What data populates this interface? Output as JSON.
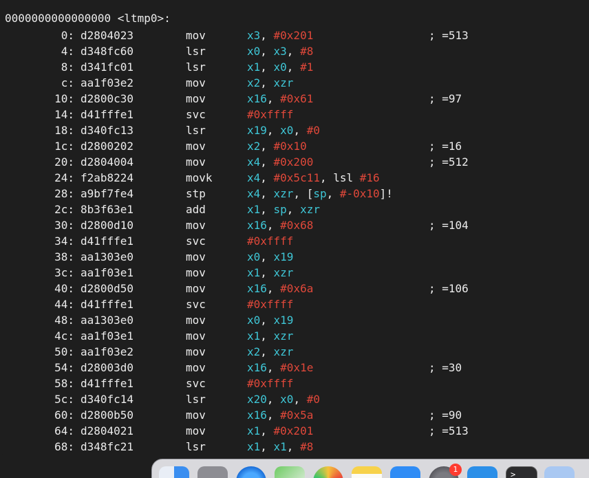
{
  "disassembly": {
    "header": "0000000000000000 <ltmp0>:",
    "rows": [
      {
        "addr": "0:",
        "hex": "d2804023",
        "mn": "mov",
        "ops": [
          {
            "t": "x3",
            "k": "reg"
          },
          {
            "t": ", ",
            "k": "pl"
          },
          {
            "t": "#0x201",
            "k": "imm"
          }
        ],
        "comment": "; =513"
      },
      {
        "addr": "4:",
        "hex": "d348fc60",
        "mn": "lsr",
        "ops": [
          {
            "t": "x0",
            "k": "reg"
          },
          {
            "t": ", ",
            "k": "pl"
          },
          {
            "t": "x3",
            "k": "reg"
          },
          {
            "t": ", ",
            "k": "pl"
          },
          {
            "t": "#8",
            "k": "imm"
          }
        ],
        "comment": ""
      },
      {
        "addr": "8:",
        "hex": "d341fc01",
        "mn": "lsr",
        "ops": [
          {
            "t": "x1",
            "k": "reg"
          },
          {
            "t": ", ",
            "k": "pl"
          },
          {
            "t": "x0",
            "k": "reg"
          },
          {
            "t": ", ",
            "k": "pl"
          },
          {
            "t": "#1",
            "k": "imm"
          }
        ],
        "comment": ""
      },
      {
        "addr": "c:",
        "hex": "aa1f03e2",
        "mn": "mov",
        "ops": [
          {
            "t": "x2",
            "k": "reg"
          },
          {
            "t": ", ",
            "k": "pl"
          },
          {
            "t": "xzr",
            "k": "reg"
          }
        ],
        "comment": ""
      },
      {
        "addr": "10:",
        "hex": "d2800c30",
        "mn": "mov",
        "ops": [
          {
            "t": "x16",
            "k": "reg"
          },
          {
            "t": ", ",
            "k": "pl"
          },
          {
            "t": "#0x61",
            "k": "imm"
          }
        ],
        "comment": "; =97"
      },
      {
        "addr": "14:",
        "hex": "d41fffe1",
        "mn": "svc",
        "ops": [
          {
            "t": "#0xffff",
            "k": "imm"
          }
        ],
        "comment": ""
      },
      {
        "addr": "18:",
        "hex": "d340fc13",
        "mn": "lsr",
        "ops": [
          {
            "t": "x19",
            "k": "reg"
          },
          {
            "t": ", ",
            "k": "pl"
          },
          {
            "t": "x0",
            "k": "reg"
          },
          {
            "t": ", ",
            "k": "pl"
          },
          {
            "t": "#0",
            "k": "imm"
          }
        ],
        "comment": ""
      },
      {
        "addr": "1c:",
        "hex": "d2800202",
        "mn": "mov",
        "ops": [
          {
            "t": "x2",
            "k": "reg"
          },
          {
            "t": ", ",
            "k": "pl"
          },
          {
            "t": "#0x10",
            "k": "imm"
          }
        ],
        "comment": "; =16"
      },
      {
        "addr": "20:",
        "hex": "d2804004",
        "mn": "mov",
        "ops": [
          {
            "t": "x4",
            "k": "reg"
          },
          {
            "t": ", ",
            "k": "pl"
          },
          {
            "t": "#0x200",
            "k": "imm"
          }
        ],
        "comment": "; =512"
      },
      {
        "addr": "24:",
        "hex": "f2ab8224",
        "mn": "movk",
        "ops": [
          {
            "t": "x4",
            "k": "reg"
          },
          {
            "t": ", ",
            "k": "pl"
          },
          {
            "t": "#0x5c11",
            "k": "imm"
          },
          {
            "t": ", lsl ",
            "k": "pl"
          },
          {
            "t": "#16",
            "k": "imm"
          }
        ],
        "comment": ""
      },
      {
        "addr": "28:",
        "hex": "a9bf7fe4",
        "mn": "stp",
        "ops": [
          {
            "t": "x4",
            "k": "reg"
          },
          {
            "t": ", ",
            "k": "pl"
          },
          {
            "t": "xzr",
            "k": "reg"
          },
          {
            "t": ", [",
            "k": "pl"
          },
          {
            "t": "sp",
            "k": "reg"
          },
          {
            "t": ", ",
            "k": "pl"
          },
          {
            "t": "#-0x10",
            "k": "imm"
          },
          {
            "t": "]!",
            "k": "pl"
          }
        ],
        "comment": ""
      },
      {
        "addr": "2c:",
        "hex": "8b3f63e1",
        "mn": "add",
        "ops": [
          {
            "t": "x1",
            "k": "reg"
          },
          {
            "t": ", ",
            "k": "pl"
          },
          {
            "t": "sp",
            "k": "reg"
          },
          {
            "t": ", ",
            "k": "pl"
          },
          {
            "t": "xzr",
            "k": "reg"
          }
        ],
        "comment": ""
      },
      {
        "addr": "30:",
        "hex": "d2800d10",
        "mn": "mov",
        "ops": [
          {
            "t": "x16",
            "k": "reg"
          },
          {
            "t": ", ",
            "k": "pl"
          },
          {
            "t": "#0x68",
            "k": "imm"
          }
        ],
        "comment": "; =104"
      },
      {
        "addr": "34:",
        "hex": "d41fffe1",
        "mn": "svc",
        "ops": [
          {
            "t": "#0xffff",
            "k": "imm"
          }
        ],
        "comment": ""
      },
      {
        "addr": "38:",
        "hex": "aa1303e0",
        "mn": "mov",
        "ops": [
          {
            "t": "x0",
            "k": "reg"
          },
          {
            "t": ", ",
            "k": "pl"
          },
          {
            "t": "x19",
            "k": "reg"
          }
        ],
        "comment": ""
      },
      {
        "addr": "3c:",
        "hex": "aa1f03e1",
        "mn": "mov",
        "ops": [
          {
            "t": "x1",
            "k": "reg"
          },
          {
            "t": ", ",
            "k": "pl"
          },
          {
            "t": "xzr",
            "k": "reg"
          }
        ],
        "comment": ""
      },
      {
        "addr": "40:",
        "hex": "d2800d50",
        "mn": "mov",
        "ops": [
          {
            "t": "x16",
            "k": "reg"
          },
          {
            "t": ", ",
            "k": "pl"
          },
          {
            "t": "#0x6a",
            "k": "imm"
          }
        ],
        "comment": "; =106"
      },
      {
        "addr": "44:",
        "hex": "d41fffe1",
        "mn": "svc",
        "ops": [
          {
            "t": "#0xffff",
            "k": "imm"
          }
        ],
        "comment": ""
      },
      {
        "addr": "48:",
        "hex": "aa1303e0",
        "mn": "mov",
        "ops": [
          {
            "t": "x0",
            "k": "reg"
          },
          {
            "t": ", ",
            "k": "pl"
          },
          {
            "t": "x19",
            "k": "reg"
          }
        ],
        "comment": ""
      },
      {
        "addr": "4c:",
        "hex": "aa1f03e1",
        "mn": "mov",
        "ops": [
          {
            "t": "x1",
            "k": "reg"
          },
          {
            "t": ", ",
            "k": "pl"
          },
          {
            "t": "xzr",
            "k": "reg"
          }
        ],
        "comment": ""
      },
      {
        "addr": "50:",
        "hex": "aa1f03e2",
        "mn": "mov",
        "ops": [
          {
            "t": "x2",
            "k": "reg"
          },
          {
            "t": ", ",
            "k": "pl"
          },
          {
            "t": "xzr",
            "k": "reg"
          }
        ],
        "comment": ""
      },
      {
        "addr": "54:",
        "hex": "d28003d0",
        "mn": "mov",
        "ops": [
          {
            "t": "x16",
            "k": "reg"
          },
          {
            "t": ", ",
            "k": "pl"
          },
          {
            "t": "#0x1e",
            "k": "imm"
          }
        ],
        "comment": "; =30"
      },
      {
        "addr": "58:",
        "hex": "d41fffe1",
        "mn": "svc",
        "ops": [
          {
            "t": "#0xffff",
            "k": "imm"
          }
        ],
        "comment": ""
      },
      {
        "addr": "5c:",
        "hex": "d340fc14",
        "mn": "lsr",
        "ops": [
          {
            "t": "x20",
            "k": "reg"
          },
          {
            "t": ", ",
            "k": "pl"
          },
          {
            "t": "x0",
            "k": "reg"
          },
          {
            "t": ", ",
            "k": "pl"
          },
          {
            "t": "#0",
            "k": "imm"
          }
        ],
        "comment": ""
      },
      {
        "addr": "60:",
        "hex": "d2800b50",
        "mn": "mov",
        "ops": [
          {
            "t": "x16",
            "k": "reg"
          },
          {
            "t": ", ",
            "k": "pl"
          },
          {
            "t": "#0x5a",
            "k": "imm"
          }
        ],
        "comment": "; =90"
      },
      {
        "addr": "64:",
        "hex": "d2804021",
        "mn": "mov",
        "ops": [
          {
            "t": "x1",
            "k": "reg"
          },
          {
            "t": ", ",
            "k": "pl"
          },
          {
            "t": "#0x201",
            "k": "imm"
          }
        ],
        "comment": "; =513"
      },
      {
        "addr": "68:",
        "hex": "d348fc21",
        "mn": "lsr",
        "ops": [
          {
            "t": "x1",
            "k": "reg"
          },
          {
            "t": ", ",
            "k": "pl"
          },
          {
            "t": "x1",
            "k": "reg"
          },
          {
            "t": ", ",
            "k": "pl"
          },
          {
            "t": "#8",
            "k": "imm"
          }
        ],
        "comment": ""
      }
    ]
  },
  "colors": {
    "register": "#3fc6d6",
    "immediate": "#e0483a",
    "text": "#ececec",
    "background": "#1e1e1e"
  },
  "dock": {
    "icons": [
      {
        "name": "finder-icon"
      },
      {
        "name": "launchpad-icon"
      },
      {
        "name": "safari-icon"
      },
      {
        "name": "maps-icon"
      },
      {
        "name": "photos-icon"
      },
      {
        "name": "notes-icon"
      },
      {
        "name": "xcode-icon"
      },
      {
        "name": "system-settings-icon",
        "badge": "1"
      },
      {
        "name": "instruments-icon"
      },
      {
        "name": "terminal-icon",
        "label": ">_"
      },
      {
        "name": "folder-icon"
      }
    ]
  }
}
